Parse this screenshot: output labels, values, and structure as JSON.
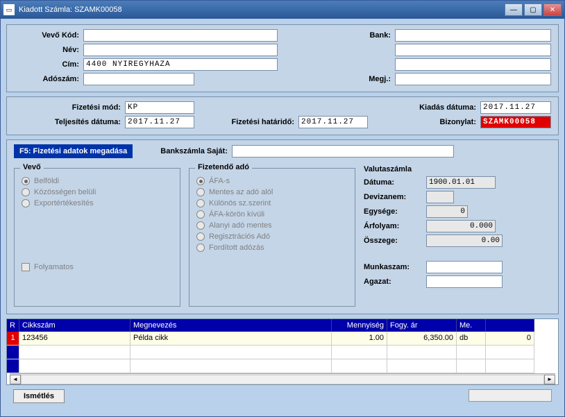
{
  "window": {
    "title": "Kiadott Számla:  SZAMK00058"
  },
  "header": {
    "vevo_kod_label": "Vevő  Kód:",
    "vevo_kod": "",
    "bank_label": "Bank:",
    "bank": "",
    "nev_label": "Név:",
    "nev": "",
    "bank2": "",
    "cim_label": "Cím:",
    "cim": "4400 NYIREGYHAZA",
    "bank3": "",
    "adoszam_label": "Adószám:",
    "adoszam": "",
    "megj_label": "Megj.:",
    "megj": ""
  },
  "pay": {
    "fizmod_label": "Fizetési mód:",
    "fizmod": "KP",
    "kiadas_label": "Kiadás dátuma:",
    "kiadas": "2017.11.27",
    "telj_label": "Teljesítés dátuma:",
    "telj": "2017.11.27",
    "hatarido_label": "Fizetési határidő:",
    "hatarido": "2017.11.27",
    "bizonylat_label": "Bizonylat:",
    "bizonylat": "SZAMK00058"
  },
  "f5": {
    "label": "F5: Fizetési adatok megadása",
    "banksz_label": "Bankszámla Saját:",
    "banksz": ""
  },
  "vevo_group": {
    "title": "Vevő",
    "r1": "Belföldi",
    "r2": "Közösségen belüli",
    "r3": "Exportértékesítés",
    "chk": "Folyamatos"
  },
  "ado_group": {
    "title": "Fizetendő adó",
    "r1": "ÁFA-s",
    "r2": "Mentes az adó alól",
    "r3": "Különös sz.szerint",
    "r4": "ÁFA-körön kívüli",
    "r5": "Alanyi adó mentes",
    "r6": "Regisztrációs Adó",
    "r7": "Fordított adózás"
  },
  "valuta": {
    "title": "Valutaszámla",
    "datum_label": "Dátuma:",
    "datum": "1900.01.01",
    "deviza_label": "Devizanem:",
    "deviza": "",
    "egyseg_label": "Egysége:",
    "egyseg": "0",
    "arfolyam_label": "Árfolyam:",
    "arfolyam": "0.000",
    "osszeg_label": "Összege:",
    "osszeg": "0.00",
    "munkaszam_label": "Munkaszam:",
    "munkaszam": "",
    "agazat_label": "Agazat:",
    "agazat": ""
  },
  "table": {
    "cols": {
      "r": "R",
      "cikk": "Cikkszám",
      "megnev": "Megnevezés",
      "menny": "Mennyiség",
      "fogy": "Fogy. ár",
      "me": "Me.",
      "last": ""
    },
    "rows": [
      {
        "r": "1",
        "cikk": "123456",
        "megnev": "Példa cikk",
        "menny": "1.00",
        "fogy": "6,350.00",
        "me": "db",
        "last": "0"
      }
    ]
  },
  "footer": {
    "ismetles": "Ismétlés",
    "right": ""
  }
}
